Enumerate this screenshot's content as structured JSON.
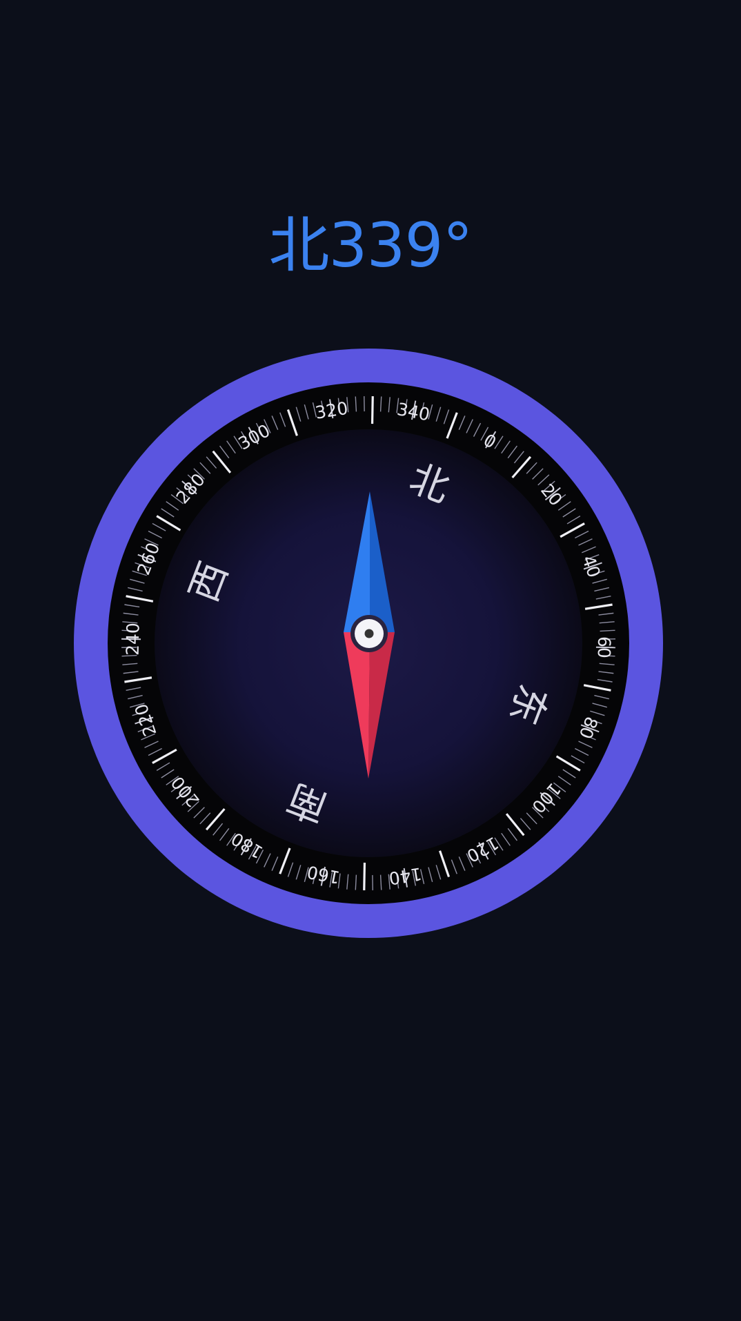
{
  "heading": {
    "direction": "北",
    "degrees": "339",
    "degree_symbol": "°"
  },
  "compass": {
    "heading_degrees": 339,
    "dial_labels": [
      "0",
      "20",
      "40",
      "60",
      "80",
      "100",
      "120",
      "140",
      "160",
      "180",
      "200",
      "220",
      "240",
      "260",
      "280",
      "300",
      "320",
      "340"
    ],
    "cardinals": {
      "north": "北",
      "east": "东",
      "south": "南",
      "west": "西"
    }
  },
  "colors": {
    "background": "#0c0f1a",
    "heading_text": "#3b82f0",
    "outer_ring": "#5b55e0",
    "dial_band": "#050507",
    "dial_face_center": "#1c1946",
    "dial_face_edge": "#0b0a18",
    "needle_north": "#2f7ef0",
    "needle_north_shade": "#1b5fc9",
    "needle_south": "#ef3b5b",
    "needle_south_shade": "#c92a48",
    "hub_ring": "#2a2440",
    "hub_fill": "#f4f4f8",
    "hub_dot": "#333333",
    "label_text": "#e6e6ee",
    "cardinal_text": "#d6d6e2"
  }
}
